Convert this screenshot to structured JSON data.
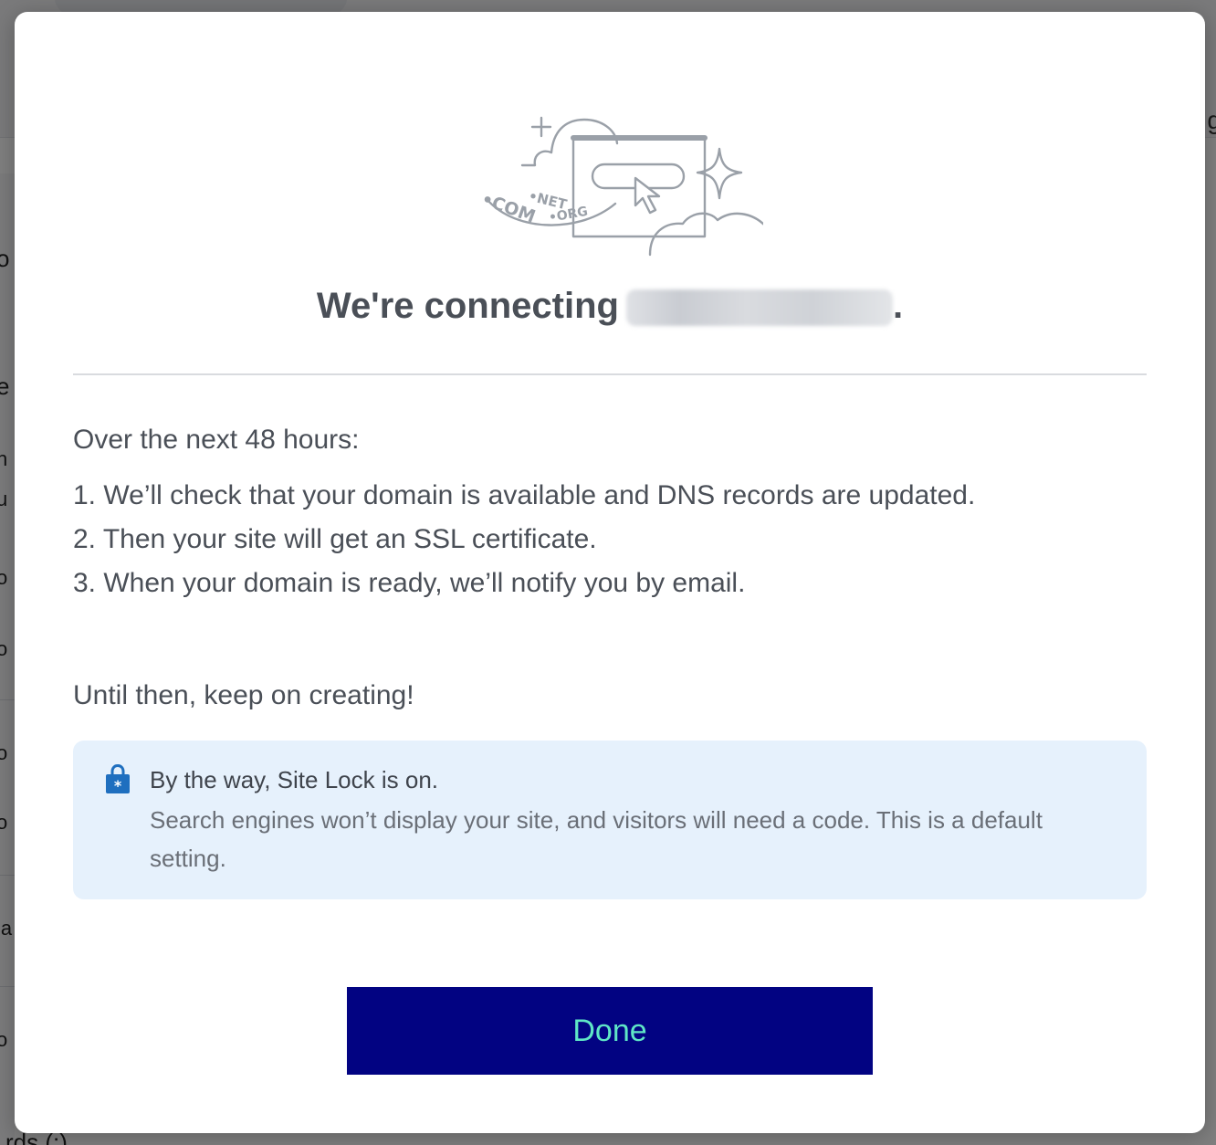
{
  "background": {
    "right_fragment": "g",
    "bottom_fragment": "rds (:)",
    "left_fragments": [
      "o",
      "e",
      "h",
      "u",
      "o",
      "o",
      "o",
      "o",
      "la",
      "o"
    ]
  },
  "modal": {
    "title_prefix": "We're connecting",
    "title_suffix": ".",
    "illustration_labels": {
      "net": "•NET",
      "com": "•COM",
      "org": "•ORG"
    },
    "section_heading": "Over the next 48 hours:",
    "steps": [
      "1. We’ll check that your domain is available and DNS records are updated.",
      "2. Then your site will get an SSL certificate.",
      "3. When your domain is ready, we’ll notify you by email."
    ],
    "until_text": "Until then, keep on creating!",
    "info_box": {
      "icon": "lock-icon",
      "title": "By the way, Site Lock is on.",
      "body": "Search engines won’t display your site, and visitors will need a code. This is a default setting."
    },
    "done_label": "Done"
  },
  "colors": {
    "button_bg": "#020382",
    "button_text": "#5fe6c6",
    "info_bg": "#e6f1fc",
    "lock_icon": "#1f6fbf",
    "text": "#4a4f57"
  }
}
